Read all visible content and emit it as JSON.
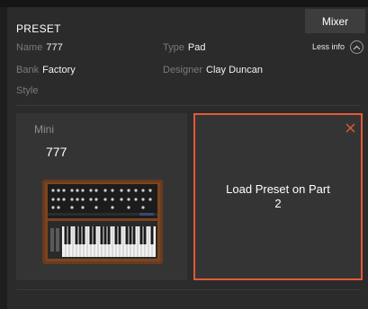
{
  "header": {
    "title": "PRESET",
    "mixer_label": "Mixer",
    "less_info_label": "Less info"
  },
  "fields": {
    "name_label": "Name",
    "name_value": "777",
    "type_label": "Type",
    "type_value": "Pad",
    "bank_label": "Bank",
    "bank_value": "Factory",
    "designer_label": "Designer",
    "designer_value": "Clay Duncan",
    "style_label": "Style"
  },
  "parts": {
    "part1": {
      "instrument": "Mini",
      "preset_name": "777"
    },
    "part2": {
      "load_label": "Load Preset on Part 2"
    }
  },
  "colors": {
    "accent": "#e25a35",
    "background": "#2b2b2b",
    "card": "#343434"
  },
  "icons": {
    "collapse": "chevron-up-icon",
    "close": "close-icon",
    "instrument": "synth-image"
  }
}
